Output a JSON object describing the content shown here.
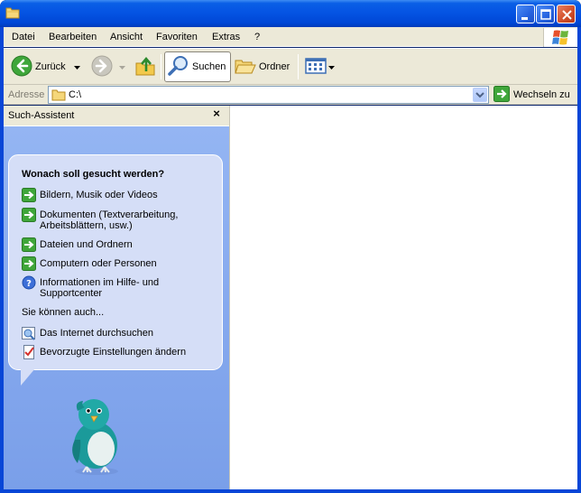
{
  "window": {
    "title": "",
    "colors": {
      "titlebar": "#0554E3",
      "chrome": "#ECE9D8",
      "pane": "#86A9EE",
      "bubble": "#D5DEF7"
    }
  },
  "menu": {
    "items": [
      "Datei",
      "Bearbeiten",
      "Ansicht",
      "Favoriten",
      "Extras",
      "?"
    ]
  },
  "toolbar": {
    "back_label": "Zurück",
    "search_label": "Suchen",
    "folders_label": "Ordner"
  },
  "address": {
    "label": "Adresse",
    "value": "C:\\",
    "go_label": "Wechseln zu"
  },
  "search_pane": {
    "title": "Such-Assistent",
    "close": "×",
    "question": "Wonach soll gesucht werden?",
    "options": [
      {
        "icon": "green-arrow-icon",
        "line1": "Bildern, Musik oder Videos",
        "line2": ""
      },
      {
        "icon": "green-arrow-icon",
        "line1": "Dokumenten (Textverarbeitung,",
        "line2": "Arbeitsblättern, usw.)"
      },
      {
        "icon": "green-arrow-icon",
        "line1": "Dateien und Ordnern",
        "line2": ""
      },
      {
        "icon": "green-arrow-icon",
        "line1": "Computern oder Personen",
        "line2": ""
      },
      {
        "icon": "help-icon",
        "line1": "Informationen im Hilfe- und",
        "line2": "Supportcenter"
      }
    ],
    "also_label": "Sie können auch...",
    "extras": [
      {
        "icon": "internet-search-icon",
        "label": "Das Internet durchsuchen"
      },
      {
        "icon": "preferences-icon",
        "label": "Bevorzugte Einstellungen ändern"
      }
    ]
  }
}
